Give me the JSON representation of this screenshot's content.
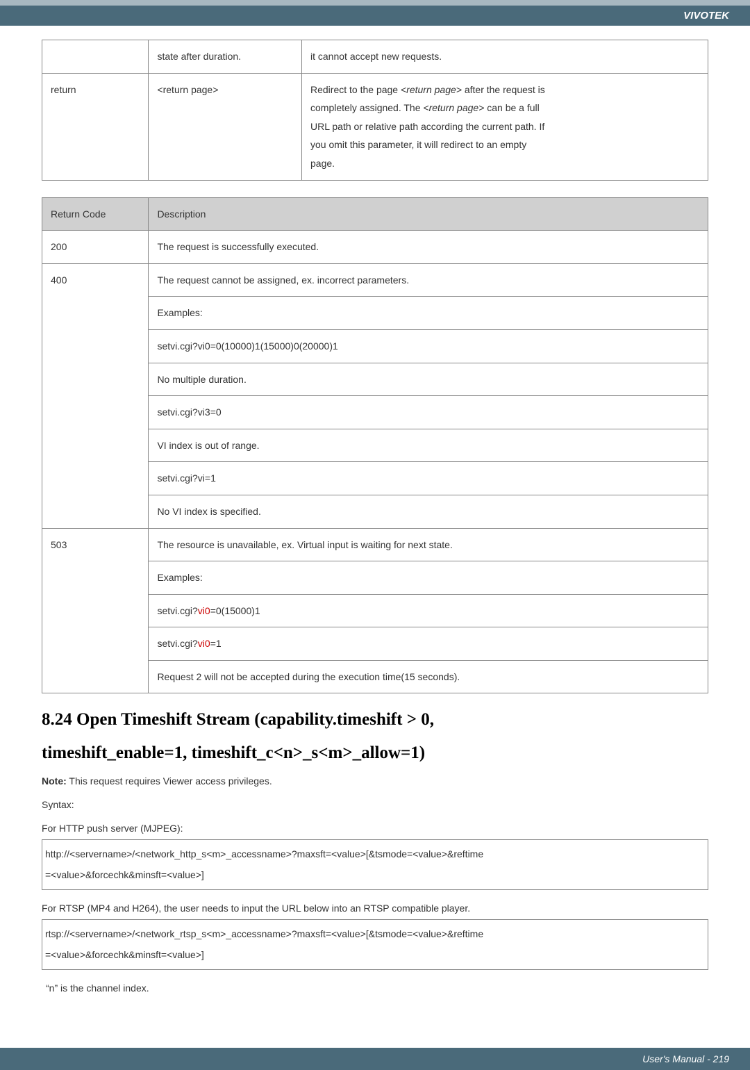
{
  "header": {
    "brand": "VIVOTEK"
  },
  "table1": {
    "row1": {
      "c2": "state after duration.",
      "c3": "it cannot accept new requests."
    },
    "row2": {
      "c1": "return",
      "c2": "<return page>",
      "c3_l1": "Redirect to the page ",
      "c3_l1i": "<return page>",
      "c3_l1b": " after the request is",
      "c3_l2a": "completely assigned. The ",
      "c3_l2i": "<return page>",
      "c3_l2b": " can be a full",
      "c3_l3": "URL path or relative path according the current path. If",
      "c3_l4": "you omit this parameter, it will redirect to an empty",
      "c3_l5": "page."
    }
  },
  "table2": {
    "h1": "Return Code",
    "h2": "Description",
    "r1c1": "200",
    "r1c2": "The request is successfully executed.",
    "r2c1": "400",
    "r2l1": "The request cannot be assigned, ex. incorrect parameters.",
    "r2l2": "Examples:",
    "r2l3": "setvi.cgi?vi0=0(10000)1(15000)0(20000)1",
    "r2l4": "No multiple duration.",
    "r2l5": "setvi.cgi?vi3=0",
    "r2l6": "VI index is out of range.",
    "r2l7": "setvi.cgi?vi=1",
    "r2l8": "No VI index is specified.",
    "r3c1": "503",
    "r3l1": "The resource is unavailable, ex. Virtual input is waiting for next state.",
    "r3l2": "Examples:",
    "r3l3a": "setvi.cgi?",
    "r3l3r": "vi0",
    "r3l3b": "=0(15000)1",
    "r3l4a": "setvi.cgi?",
    "r3l4r": "vi0",
    "r3l4b": "=1",
    "r3l5": "Request 2 will not be accepted during the execution time(15 seconds)."
  },
  "heading1": "8.24 Open Timeshift Stream (capability.timeshift > 0,",
  "heading2": "timeshift_enable=1, timeshift_c<n>_s<m>_allow=1)",
  "note_label": "Note:",
  "note_text": " This request requires Viewer access privileges.",
  "syntax_label": "Syntax:",
  "http_label": "For HTTP push server (MJPEG):",
  "http_box_l1": "http://<servername>/<network_http_s<m>_accessname>?maxsft=<value>[&tsmode=<value>&reftime",
  "http_box_l2": "=<value>&forcechk&minsft=<value>]",
  "rtsp_label": "For RTSP (MP4 and H264), the user needs to input the URL below into an RTSP compatible player.",
  "rtsp_box_l1": "rtsp://<servername>/<network_rtsp_s<m>_accessname>?maxsft=<value>[&tsmode=<value>&reftime",
  "rtsp_box_l2": "=<value>&forcechk&minsft=<value>]",
  "channel_note": "“n” is the channel index.",
  "footer": "User's Manual - 219"
}
